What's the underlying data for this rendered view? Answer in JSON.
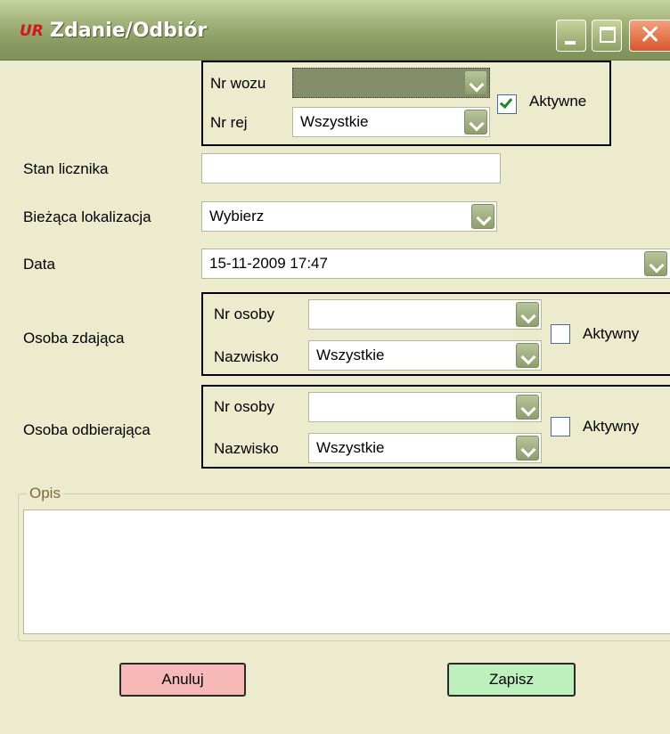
{
  "window": {
    "title": "Zdanie/Odbiór"
  },
  "vehicle": {
    "nr_wozu_label": "Nr wozu",
    "nr_wozu_value": "",
    "nr_rej_label": "Nr rej",
    "nr_rej_value": "Wszystkie",
    "aktywne_label": "Aktywne",
    "aktywne_checked": true
  },
  "form": {
    "stan_licznika_label": "Stan licznika",
    "stan_licznika_value": "",
    "lokalizacja_label": "Bieżąca lokalizacja",
    "lokalizacja_value": "Wybierz",
    "data_label": "Data",
    "data_value": "15-11-2009 17:47"
  },
  "osoba_zdajaca": {
    "label": "Osoba zdająca",
    "nr_osoby_label": "Nr osoby",
    "nr_osoby_value": "",
    "nazwisko_label": "Nazwisko",
    "nazwisko_value": "Wszystkie",
    "aktywny_label": "Aktywny",
    "aktywny_checked": false
  },
  "osoba_odbierajaca": {
    "label": "Osoba odbierająca",
    "nr_osoby_label": "Nr osoby",
    "nr_osoby_value": "",
    "nazwisko_label": "Nazwisko",
    "nazwisko_value": "Wszystkie",
    "aktywny_label": "Aktywny",
    "aktywny_checked": false
  },
  "opis": {
    "legend": "Opis",
    "value": ""
  },
  "buttons": {
    "cancel_label": "Anuluj",
    "save_label": "Zapisz"
  },
  "icons": {
    "app": "app-logo-icon",
    "minimize": "minimize-icon",
    "maximize": "maximize-icon",
    "close": "close-icon",
    "dropdown": "chevron-down-icon",
    "check": "checkmark-icon"
  },
  "colors": {
    "titlebar": "#8a9c62",
    "window_bg": "#ecebcd",
    "cancel_button": "#f7b8b8",
    "save_button": "#bdf0bd",
    "dropdown_button": "#8f9d6e"
  }
}
